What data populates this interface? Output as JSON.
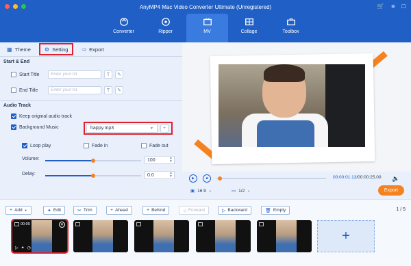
{
  "window": {
    "title": "AnyMP4 Mac Video Converter Ultimate (Unregistered)"
  },
  "nav": {
    "items": [
      {
        "label": "Converter"
      },
      {
        "label": "Ripper"
      },
      {
        "label": "MV"
      },
      {
        "label": "Collage"
      },
      {
        "label": "Toolbox"
      }
    ]
  },
  "tabs": [
    {
      "label": "Theme",
      "icon": "grid-icon"
    },
    {
      "label": "Setting",
      "icon": "gear-icon"
    },
    {
      "label": "Export",
      "icon": "export-icon"
    }
  ],
  "start_end": {
    "heading": "Start & End",
    "start_label": "Start Title",
    "start_placeholder": "Enter your txt",
    "end_label": "End Title",
    "end_placeholder": "Enter your txt"
  },
  "audio": {
    "heading": "Audio Track",
    "keep_original": "Keep original audio track",
    "background_music": "Background Music",
    "music_file": "happy.mp3",
    "loop_play": "Loop play",
    "fade_in": "Fade in",
    "fade_out": "Fade out",
    "volume_label": "Volume:",
    "volume_value": "100",
    "volume_level": 0.5,
    "delay_label": "Delay:",
    "delay_value": "0.0",
    "delay_level": 0.5
  },
  "player": {
    "current_time": "00:00:01.13",
    "total_time": "/00:00:25.00",
    "aspect": "16:9",
    "page": "1/2",
    "export_label": "Export",
    "accent": "#f5821f"
  },
  "toolbar": {
    "add": "Add",
    "edit": "Edit",
    "trim": "Trim",
    "ahead": "Ahead",
    "behind": "Behind",
    "forward": "Forward",
    "backward": "Backward",
    "empty": "Empty",
    "page_info": "1 / 5"
  },
  "clips": {
    "first_duration": "00:00"
  }
}
